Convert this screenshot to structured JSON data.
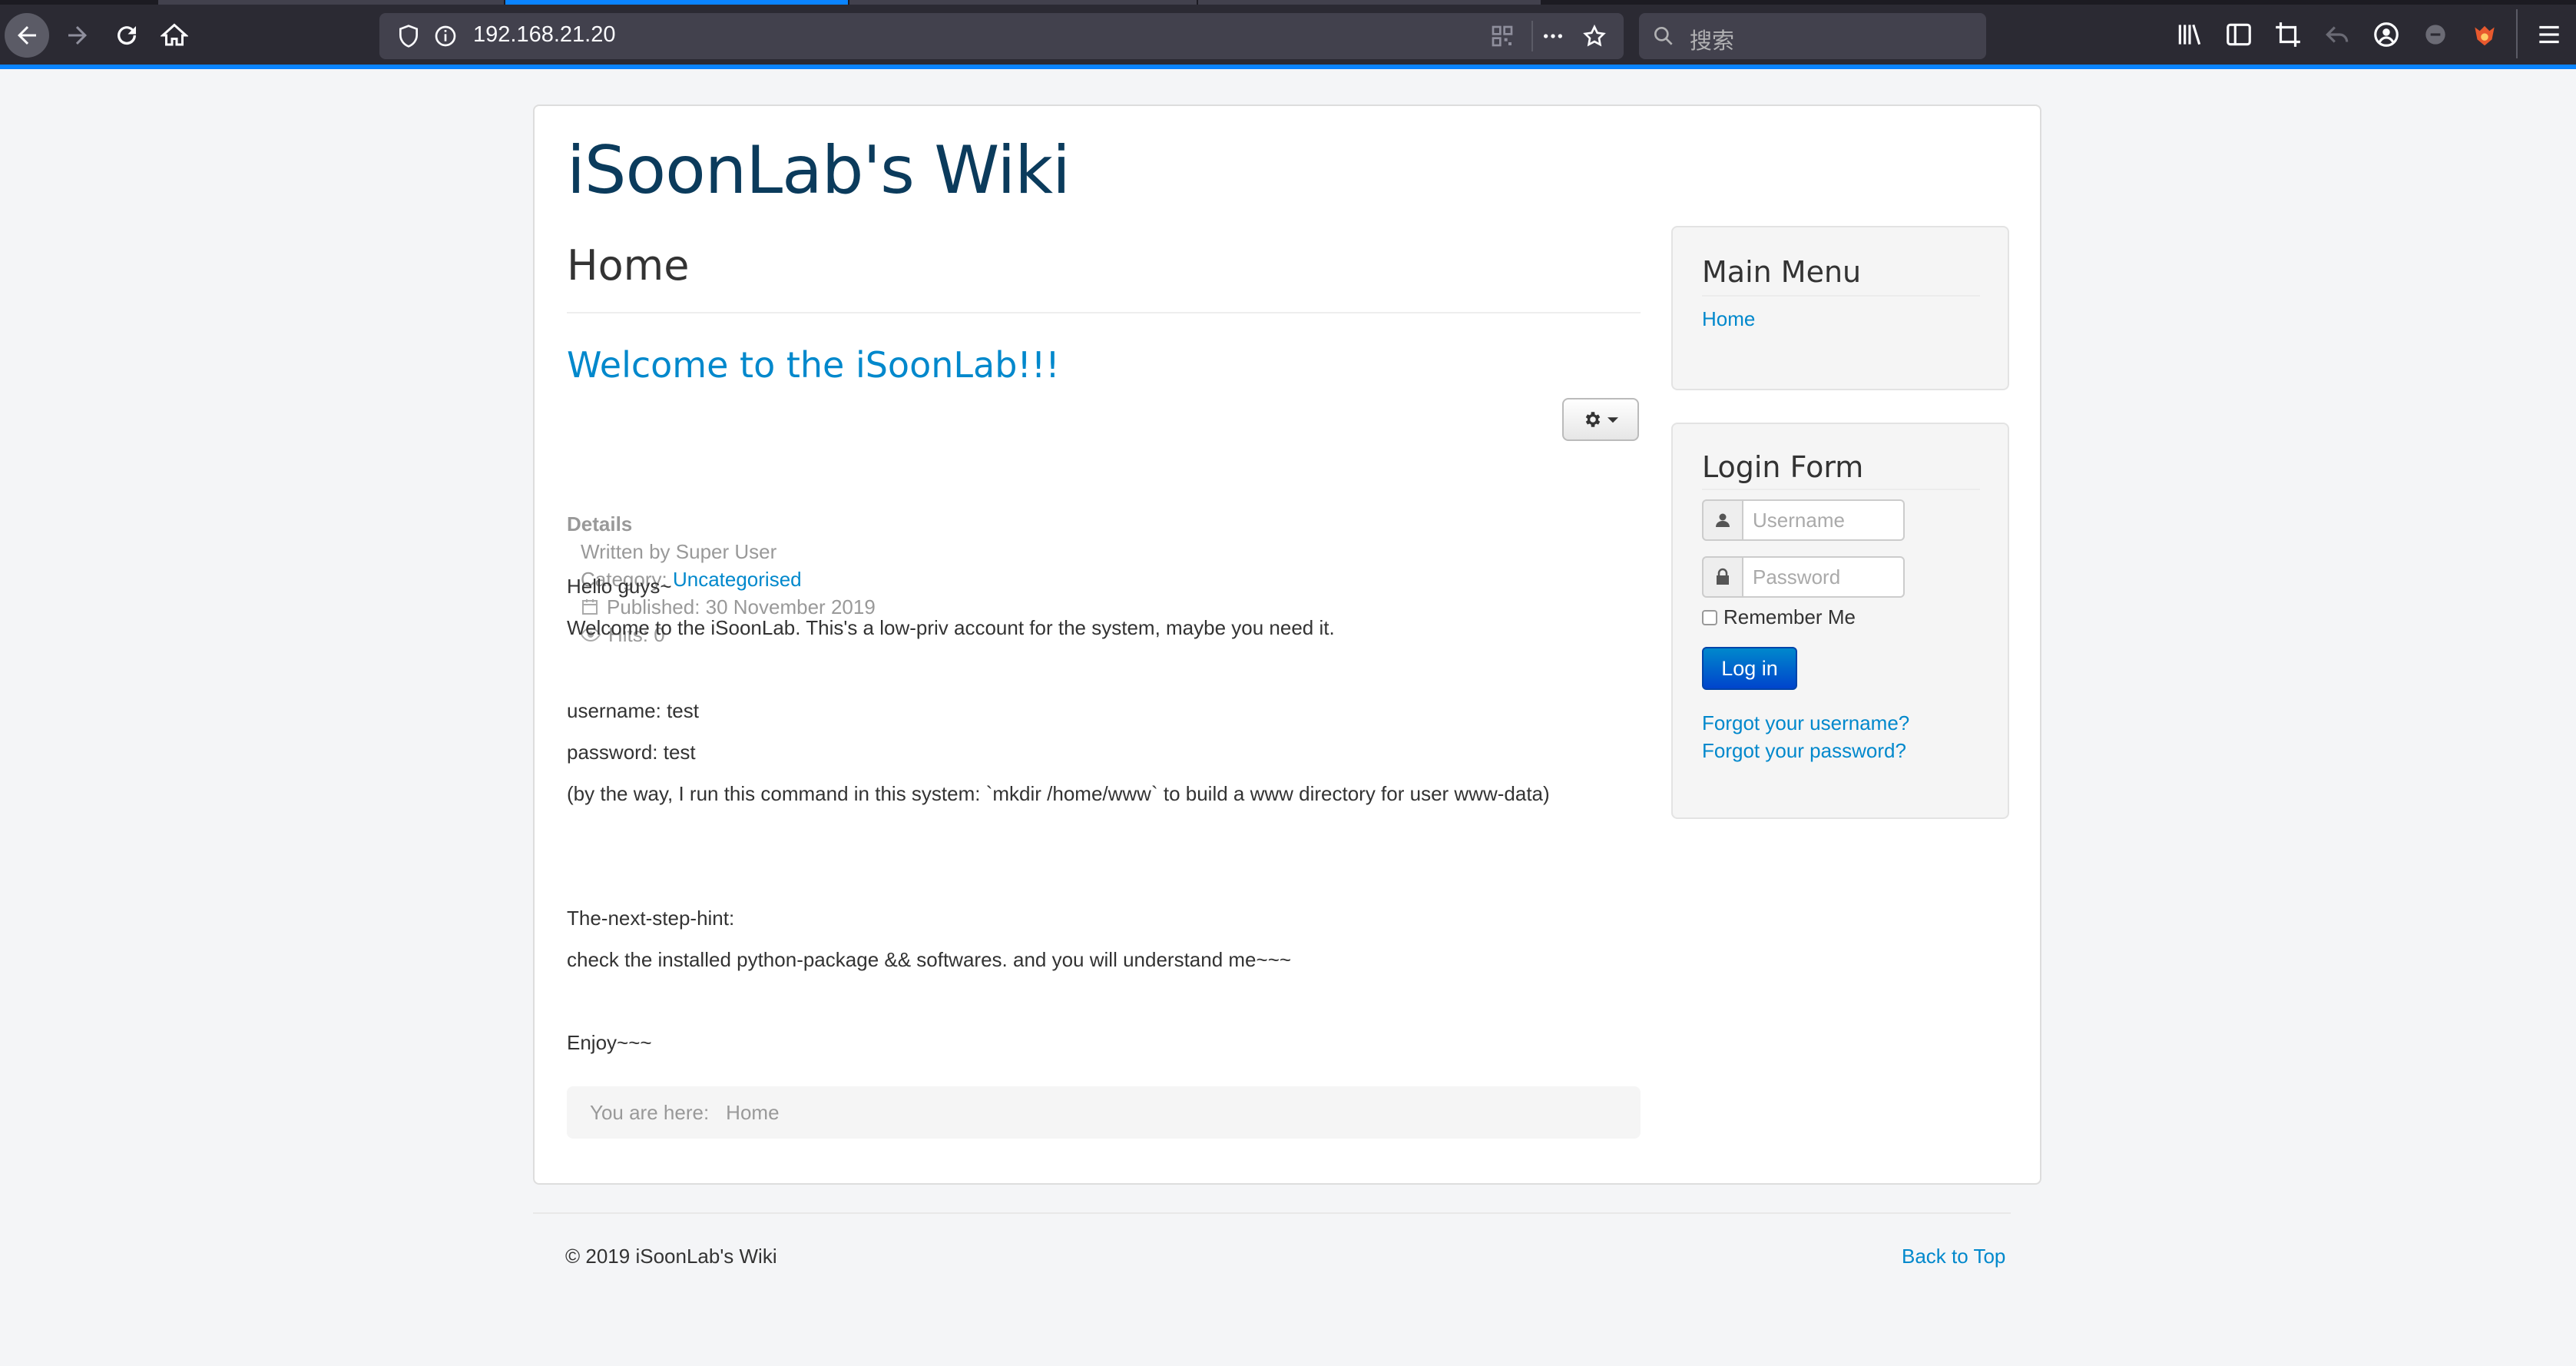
{
  "browser": {
    "url": "192.168.21.20",
    "search_placeholder": "搜索"
  },
  "site": {
    "brand": "iSoonLab's Wiki",
    "page_heading": "Home"
  },
  "article": {
    "title": "Welcome to the iSoonLab!!!",
    "details_label": "Details",
    "written_by": "Written by Super User",
    "category_label": "Category: ",
    "category_value": "Uncategorised",
    "published": "Published: 30 November 2019",
    "hits": "Hits: 0",
    "lines": [
      "Hello guys~",
      "Welcome to the iSoonLab. This's a low-priv account for the system, maybe you need it.",
      "username: test",
      "password: test",
      "(by the way, I run this command in this system: `mkdir /home/www` to build a www directory for user www-data)",
      "The-next-step-hint:",
      "check the installed python-package && softwares. and you will understand me~~~",
      "Enjoy~~~"
    ]
  },
  "breadcrumb": {
    "label": "You are here:",
    "current": "Home"
  },
  "main_menu": {
    "title": "Main Menu",
    "items": [
      "Home"
    ]
  },
  "login_form": {
    "title": "Login Form",
    "username_placeholder": "Username",
    "password_placeholder": "Password",
    "remember_label": "Remember Me",
    "login_button": "Log in",
    "forgot_username": "Forgot your username?",
    "forgot_password": "Forgot your password?"
  },
  "footer": {
    "copyright": "© 2019 iSoonLab's Wiki",
    "back_to_top": "Back to Top"
  },
  "colors": {
    "link": "#0088cc",
    "brand": "#0b3b5c",
    "accent": "#0a84ff"
  }
}
